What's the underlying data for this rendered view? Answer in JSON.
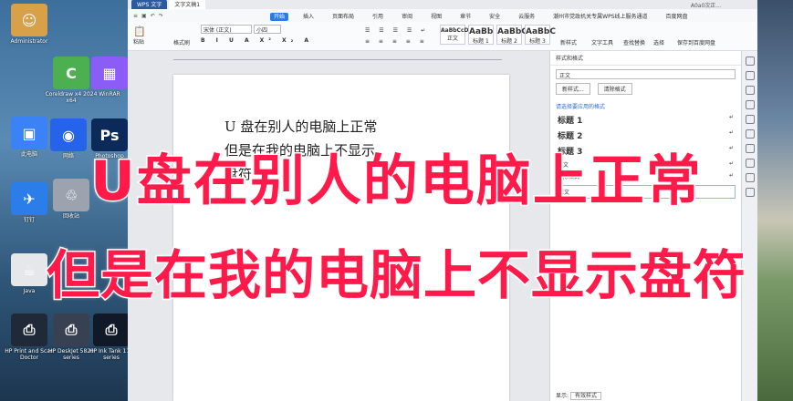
{
  "desktop": {
    "icons": [
      {
        "label": "Administrator",
        "color": "#d9a04a",
        "glyph": "☺"
      },
      {
        "label": "Coreldraw x4 2024 x64",
        "color": "#4caf50",
        "glyph": "C"
      },
      {
        "label": "WinRAR",
        "color": "#8b5cf6",
        "glyph": "▦"
      },
      {
        "label": "此电脑",
        "color": "#3b82f6",
        "glyph": "▣"
      },
      {
        "label": "网络",
        "color": "#2563eb",
        "glyph": "◉"
      },
      {
        "label": "Photoshop",
        "color": "#0b2a5a",
        "glyph": "Ps"
      },
      {
        "label": "钉钉",
        "color": "#2b7de9",
        "glyph": "✈"
      },
      {
        "label": "回收站",
        "color": "#9ca3af",
        "glyph": "♲"
      },
      {
        "label": "Java",
        "color": "#e5e7eb",
        "glyph": "☕"
      },
      {
        "label": "HP Print and Scan Doctor",
        "color": "#1f2937",
        "glyph": "⎙"
      },
      {
        "label": "HP DeskJet 5820 series",
        "color": "#374151",
        "glyph": "⎙"
      },
      {
        "label": "HP Ink Tank 110 series",
        "color": "#111827",
        "glyph": "⎙"
      }
    ]
  },
  "window": {
    "app_tab": "WPS 文字",
    "doc_tab": "文字文稿1",
    "user": "A0a0次正...",
    "menu": [
      "开始",
      "插入",
      "页面布局",
      "引用",
      "审阅",
      "视图",
      "章节",
      "安全",
      "云服务",
      "潮州市党政机关专属WPS线上服务通道",
      "百度网盘"
    ],
    "active_menu": "开始",
    "ribbon": {
      "paste": "粘贴",
      "format_painter": "格式刷",
      "font_name": "宋体 (正文)",
      "font_size": "小四",
      "styles": [
        {
          "sample": "AaBbCcDd",
          "name": "正文"
        },
        {
          "sample": "AaBb",
          "name": "标题 1"
        },
        {
          "sample": "AaBbC",
          "name": "标题 2"
        },
        {
          "sample": "AaBbC",
          "name": "标题 3"
        }
      ],
      "new_style": "新样式",
      "text_tools": "文字工具",
      "find_replace": "查找替换",
      "select": "选择",
      "save_baidu": "保存到百度网盘"
    }
  },
  "document": {
    "lines": [
      "U 盘在别人的电脑上正常",
      "但是在我的电脑上不显示",
      "盘符"
    ]
  },
  "panel": {
    "title": "样式和格式",
    "current_style": "正文",
    "new_style_btn": "新样式...",
    "clear_format_btn": "清除格式",
    "section_label": "请选择要应用的格式",
    "styles": [
      "标题 1",
      "标题 2",
      "标题 3",
      "正文",
      "清除格式"
    ],
    "normal_box": "正文",
    "display_label": "显示",
    "display_value": "有效样式"
  },
  "captions": {
    "line1": "U盘在别人的电脑上正常",
    "line2": "但是在我的电脑上不显示盘符"
  }
}
